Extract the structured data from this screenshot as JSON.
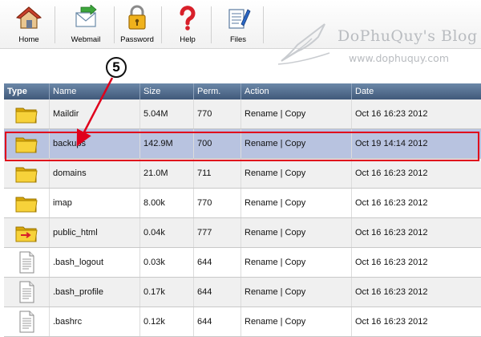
{
  "toolbar": {
    "items": [
      {
        "label": "Home",
        "icon": "home-icon"
      },
      {
        "label": "Webmail",
        "icon": "webmail-icon"
      },
      {
        "label": "Password",
        "icon": "lock-icon"
      },
      {
        "label": "Help",
        "icon": "help-icon"
      },
      {
        "label": "Files",
        "icon": "files-icon"
      }
    ]
  },
  "watermark": {
    "title": "DoPhuQuy's Blog",
    "url": "www.dophuquy.com"
  },
  "annotation": {
    "step_number": "5"
  },
  "table": {
    "headers": [
      "Type",
      "Name",
      "Size",
      "Perm.",
      "Action",
      "Date"
    ],
    "rows": [
      {
        "type": "folder",
        "name": "Maildir",
        "size": "5.04M",
        "perm": "770",
        "action": "Rename | Copy",
        "date": "Oct 16 16:23 2012"
      },
      {
        "type": "folder",
        "name": "backups",
        "size": "142.9M",
        "perm": "700",
        "action": "Rename | Copy",
        "date": "Oct 19 14:14 2012",
        "selected": true
      },
      {
        "type": "folder",
        "name": "domains",
        "size": "21.0M",
        "perm": "711",
        "action": "Rename | Copy",
        "date": "Oct 16 16:23 2012"
      },
      {
        "type": "folder",
        "name": "imap",
        "size": "8.00k",
        "perm": "770",
        "action": "Rename | Copy",
        "date": "Oct 16 16:23 2012"
      },
      {
        "type": "folder-link",
        "name": "public_html",
        "size": "0.04k",
        "perm": "777",
        "action": "Rename | Copy",
        "date": "Oct 16 16:23 2012"
      },
      {
        "type": "file",
        "name": ".bash_logout",
        "size": "0.03k",
        "perm": "644",
        "action": "Rename | Copy",
        "date": "Oct 16 16:23 2012"
      },
      {
        "type": "file",
        "name": ".bash_profile",
        "size": "0.17k",
        "perm": "644",
        "action": "Rename | Copy",
        "date": "Oct 16 16:23 2012"
      },
      {
        "type": "file",
        "name": ".bashrc",
        "size": "0.12k",
        "perm": "644",
        "action": "Rename | Copy",
        "date": "Oct 16 16:23 2012"
      }
    ]
  },
  "colors": {
    "header_bg": "#4f6a8c",
    "selected_row": "#b8c3e0",
    "highlight": "#e0001c",
    "folder": "#f2c51c"
  }
}
